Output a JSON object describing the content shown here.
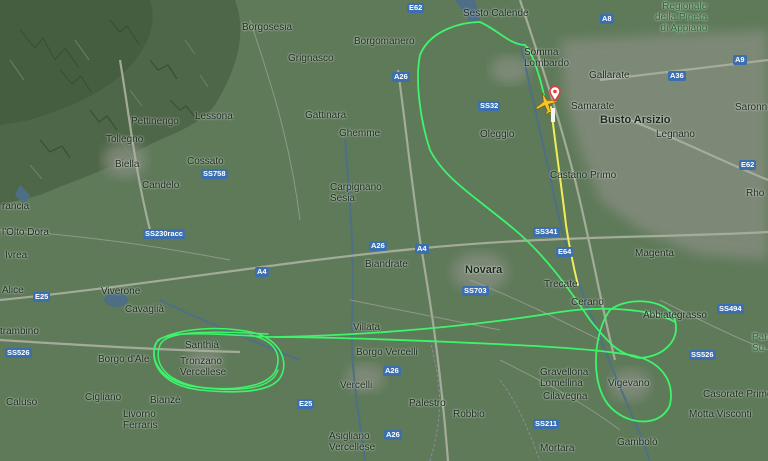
{
  "map": {
    "colors": {
      "terrain": "#5f7a5a",
      "urban": "#8c9486",
      "water": "#4f6f8a",
      "route_green": "#3df46c",
      "route_yellow": "#f2ec58",
      "plane": "#f7c325",
      "pin": "#e23b3b"
    },
    "places": {
      "borgosesia": "Borgosesia",
      "sesto_calende": "Sesto Calende",
      "borgomanero": "Borgomanero",
      "grignasco": "Grignasco",
      "somma": "Somma\nLombardo",
      "gallarate": "Gallarate",
      "samarate": "Samarate",
      "busto": "Busto Arsizio",
      "legnano": "Legnano",
      "saronno": "Saronno",
      "rho": "Rho",
      "parco_appiano": "Regionale\ndella Pineta\ndi Appiano",
      "pettinengo": "Pettinengo",
      "tollegno": "Tollegno",
      "lessona": "Lessona",
      "biella": "Biella",
      "cossato": "Cossato",
      "candelo": "Candelo",
      "gattinara": "Gattinara",
      "ghemme": "Ghemme",
      "oleggio": "Oleggio",
      "castano": "Castano Primo",
      "carpignano": "Carpignano\nSesia",
      "magenta": "Magenta",
      "francia": "rancia",
      "dolto": "l'Olto Dora",
      "ivrea": "Ivrea",
      "alice": "Alice",
      "viverone": "Viverone",
      "cavaglia": "Cavaglià",
      "biandrate": "Biandrate",
      "novara": "Novara",
      "trecate": "Trecate",
      "cerano": "Cerano",
      "abbiategrasso": "Abbiategrasso",
      "parco_sud": "Parc\nSu",
      "strambino": "trambino",
      "santhia": "Santhià",
      "tronzano": "Tronzano\nVercellese",
      "borgo_dale": "Borgo d'Ale",
      "villata": "Villata",
      "borgo_vercelli": "Borgo Vercelli",
      "vercelli": "Vercelli",
      "gravellona": "Gravellona\nLomellina",
      "cilavegna": "Cilavegna",
      "vigevano": "Vigevano",
      "caluso": "Caluso",
      "cigliano": "Cigliano",
      "bianze": "Bianzè",
      "livorno": "Livorno\nFerraris",
      "palestro": "Palestro",
      "robbio": "Robbio",
      "asigliano": "Asigliano\nVercellese",
      "mortara": "Mortara",
      "gambolo": "Gambolò",
      "motta": "Motta Visconti",
      "casorate": "Casorate Primo"
    },
    "shields": {
      "e62a": "E62",
      "a8": "A8",
      "a9": "A9",
      "a26a": "A26",
      "a36": "A36",
      "ss32": "SS32",
      "ss758": "SS758",
      "e62b": "E62",
      "ss341": "SS341",
      "e64": "E64",
      "ss230": "SS230racc",
      "a26b": "A26",
      "a4a": "A4",
      "a4b": "A4",
      "ss703": "SS703",
      "e25a": "E25",
      "ss494": "SS494",
      "ss526a": "SS526",
      "ss526b": "SS526",
      "a26c": "A26",
      "e25b": "E25",
      "ss211": "SS211",
      "a26d": "A26"
    }
  }
}
